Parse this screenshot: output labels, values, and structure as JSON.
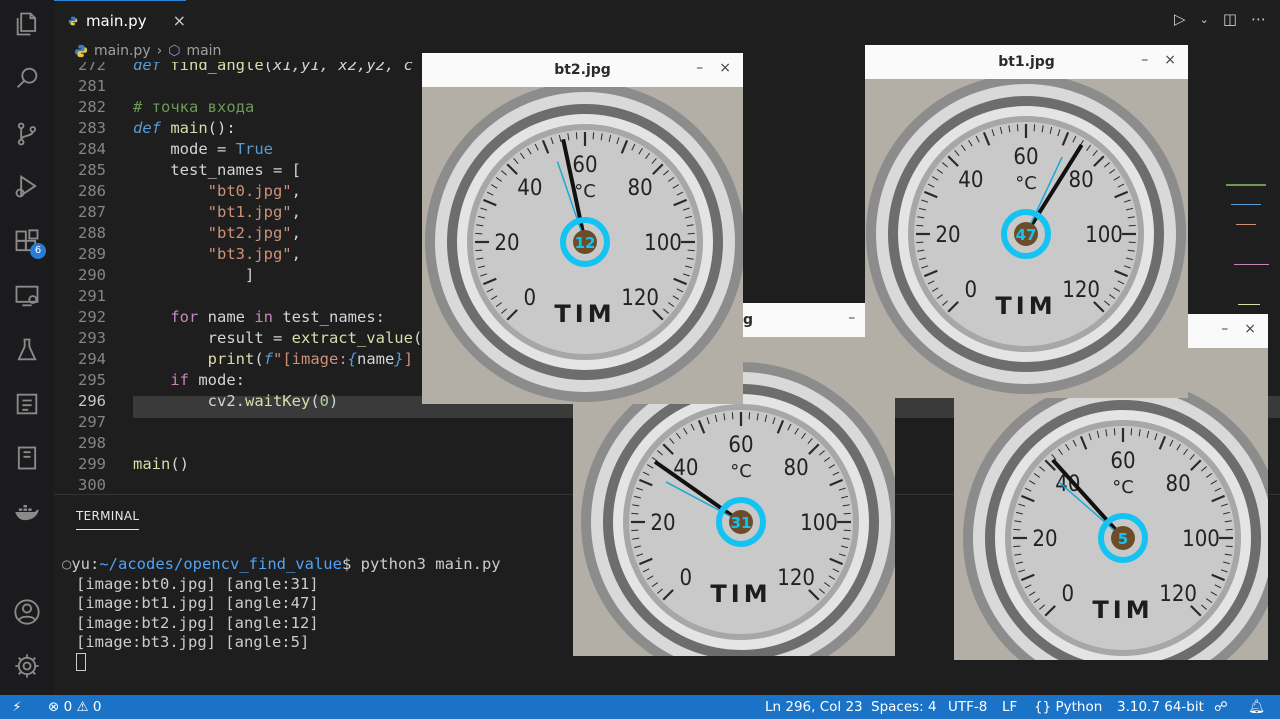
{
  "activity_bar": {
    "icons": [
      "files-icon",
      "search-icon",
      "source-control-icon",
      "run-debug-icon",
      "extensions-icon",
      "remote-explorer-icon",
      "testing-icon",
      "git-graph-icon",
      "notebook-icon",
      "docker-icon",
      "account-icon",
      "settings-gear-icon"
    ],
    "extensions_badge": "6"
  },
  "tab": {
    "label": "main.py",
    "close": "×"
  },
  "breadcrumb": {
    "file": "main.py",
    "separator": "›",
    "symbol": "main"
  },
  "editor": {
    "lines": [
      {
        "n": "272",
        "html": "<span class='kw'>def</span> <span class='fn'>find_angle</span>(<i>x1,y1, x2,y2, c</i>"
      },
      {
        "n": "281",
        "html": ""
      },
      {
        "n": "282",
        "html": "<span class='cm'># точка входа</span>"
      },
      {
        "n": "283",
        "html": "<span class='kw'>def</span> <span class='fn'>main</span>():"
      },
      {
        "n": "284",
        "html": "    mode = <span class='bool'>True</span>"
      },
      {
        "n": "285",
        "html": "    test_names = ["
      },
      {
        "n": "286",
        "html": "        <span class='str'>\"bt0.jpg\"</span>,"
      },
      {
        "n": "287",
        "html": "        <span class='str'>\"bt1.jpg\"</span>,"
      },
      {
        "n": "288",
        "html": "        <span class='str'>\"bt2.jpg\"</span>,"
      },
      {
        "n": "289",
        "html": "        <span class='str'>\"bt3.jpg\"</span>,"
      },
      {
        "n": "290",
        "html": "            ]"
      },
      {
        "n": "291",
        "html": ""
      },
      {
        "n": "292",
        "html": "    <span class='kw2'>for</span> name <span class='kw2'>in</span> test_names:"
      },
      {
        "n": "293",
        "html": "        result = <span class='fn'>extract_value</span>("
      },
      {
        "n": "294",
        "html": "        <span class='fn'>print</span>(<span class='kw'>f</span><span class='str'>\"[image:</span><span class='kw'>{</span>name<span class='kw'>}</span><span class='str'>]</span>"
      },
      {
        "n": "295",
        "html": "    <span class='kw2'>if</span> mode:"
      },
      {
        "n": "296",
        "html": "        cv2.<span class='fn'>waitKey</span>(<span class='num'>0</span>)"
      },
      {
        "n": "297",
        "html": ""
      },
      {
        "n": "298",
        "html": ""
      },
      {
        "n": "299",
        "html": "<span class='fn'>main</span>()"
      },
      {
        "n": "300",
        "html": ""
      }
    ]
  },
  "panel": {
    "tab": "TERMINAL",
    "prompt_dot": "○",
    "prompt_user": "yu:",
    "prompt_path": "~/acodes/opencv_find_value",
    "prompt_cmd": "$ python3 main.py",
    "output": [
      "[image:bt0.jpg] [angle:31]",
      "[image:bt1.jpg] [angle:47]",
      "[image:bt2.jpg] [angle:12]",
      "[image:bt3.jpg] [angle:5]"
    ]
  },
  "status": {
    "errors": "0",
    "warnings": "0",
    "position": "Ln 296, Col 23",
    "spaces": "Spaces: 4",
    "encoding": "UTF-8",
    "eol": "LF",
    "language": "Python",
    "interpreter": "3.10.7 64-bit"
  },
  "windows": [
    {
      "id": "bt0",
      "title": "bt0.jpg",
      "visible_title": "pg",
      "brand": "TIM",
      "unit": "°C",
      "value": "31"
    },
    {
      "id": "bt3",
      "title": "",
      "brand": "TIM",
      "unit": "°C",
      "value": "5"
    },
    {
      "id": "bt2",
      "title": "bt2.jpg",
      "brand": "TIM",
      "unit": "°C",
      "value": "12"
    },
    {
      "id": "bt1",
      "title": "bt1.jpg",
      "brand": "TIM",
      "unit": "°C",
      "value": "47"
    }
  ],
  "window_controls": {
    "minimize": "–",
    "close": "×"
  },
  "gauge_ticks": [
    "0",
    "20",
    "40",
    "60",
    "80",
    "100",
    "120"
  ]
}
